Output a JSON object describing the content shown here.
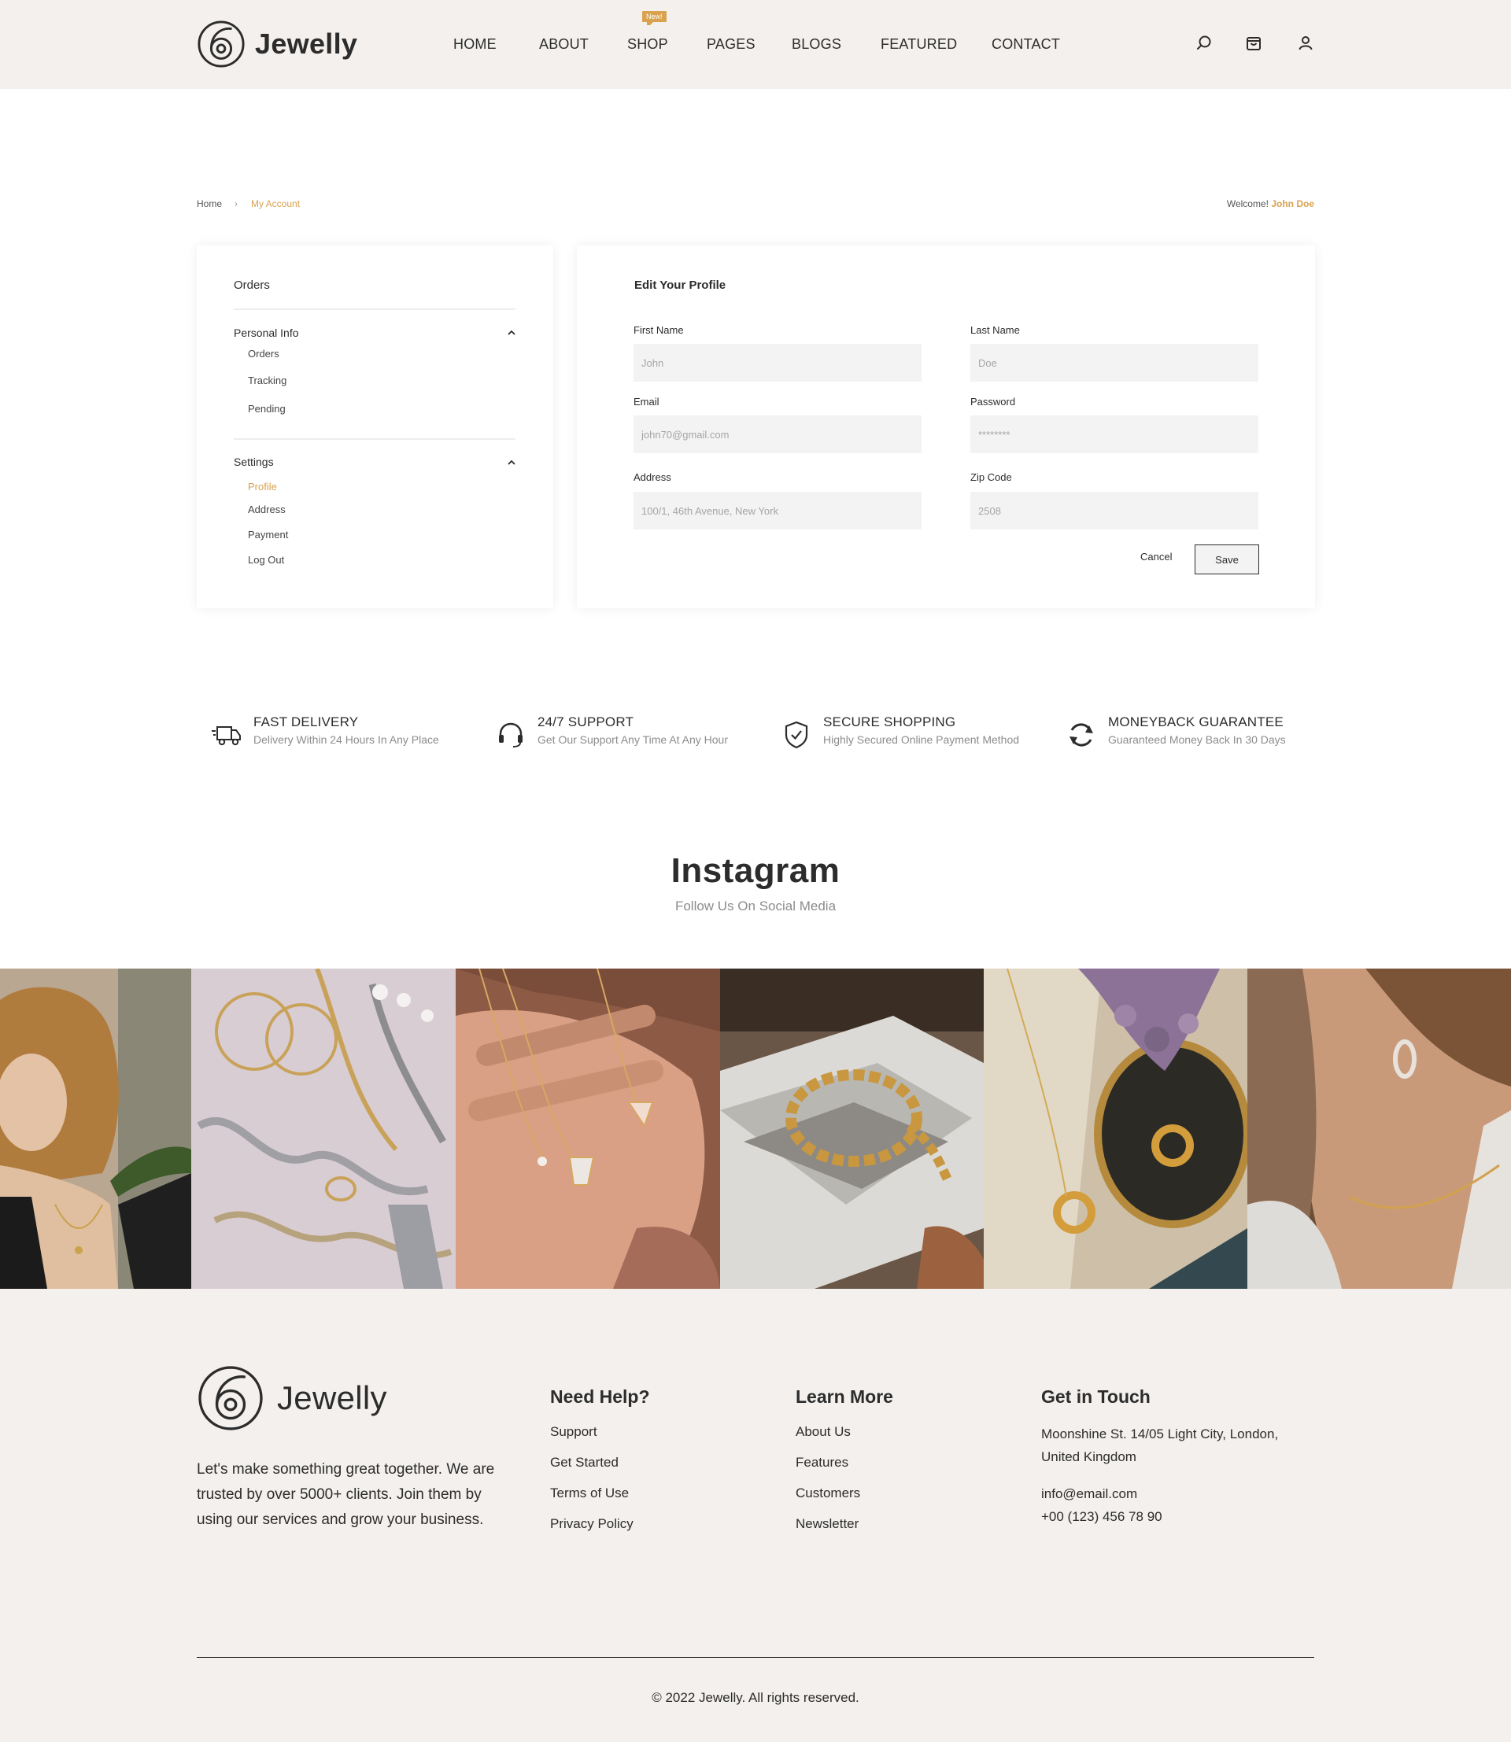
{
  "header": {
    "brand": "Jewelly",
    "nav": [
      "HOME",
      "ABOUT",
      "SHOP",
      "PAGES",
      "BLOGS",
      "FEATURED",
      "CONTACT"
    ],
    "new_badge": "New!",
    "icons": [
      "search-icon",
      "cart-icon",
      "user-icon"
    ]
  },
  "breadcrumb": {
    "home": "Home",
    "separator": "›",
    "current": "My Account"
  },
  "welcome": {
    "prefix": "Welcome!",
    "name": "John Doe"
  },
  "sidebar": {
    "orders_title": "Orders",
    "personal_info": {
      "title": "Personal Info",
      "items": [
        "Orders",
        "Tracking",
        "Pending"
      ]
    },
    "settings": {
      "title": "Settings",
      "items": [
        "Profile",
        "Address",
        "Payment",
        "Log Out"
      ],
      "active": "Profile"
    }
  },
  "profile_form": {
    "title": "Edit  Your Profile",
    "first_name": {
      "label": "First Name",
      "placeholder": "John"
    },
    "last_name": {
      "label": "Last Name",
      "placeholder": "Doe"
    },
    "email": {
      "label": "Email",
      "placeholder": "john70@gmail.com"
    },
    "password": {
      "label": "Password",
      "placeholder": "********"
    },
    "address": {
      "label": "Address",
      "placeholder": "100/1, 46th Avenue, New York"
    },
    "zip": {
      "label": "Zip Code",
      "placeholder": "2508"
    },
    "cancel_label": "Cancel",
    "save_label": "Save"
  },
  "features": [
    {
      "icon": "delivery-truck-icon",
      "title": "FAST DELIVERY",
      "subtitle": "Delivery Within 24 Hours In Any Place"
    },
    {
      "icon": "headset-icon",
      "title": "24/7 SUPPORT",
      "subtitle": "Get Our Support Any Time At Any Hour"
    },
    {
      "icon": "shield-check-icon",
      "title": "SECURE SHOPPING",
      "subtitle": "Highly Secured Online Payment Method"
    },
    {
      "icon": "refresh-icon",
      "title": "MONEYBACK GUARANTEE",
      "subtitle": "Guaranteed Money Back In 30 Days"
    }
  ],
  "instagram": {
    "title": "Instagram",
    "subtitle": "Follow Us On Social Media"
  },
  "footer": {
    "brand": "Jewelly",
    "about": "Let's make something great together. We are trusted by over 5000+ clients. Join them by using our services and grow your business.",
    "need_help": {
      "title": "Need Help?",
      "links": [
        "Support",
        "Get Started",
        "Terms of Use",
        "Privacy Policy"
      ]
    },
    "learn_more": {
      "title": "Learn More",
      "links": [
        "About Us",
        "Features",
        "Customers",
        "Newsletter"
      ]
    },
    "get_in_touch": {
      "title": "Get in Touch",
      "address": "Moonshine St. 14/05 Light City, London, United Kingdom",
      "email": "info@email.com",
      "phone": "+00 (123) 456 78 90"
    },
    "copyright": "© 2022 Jewelly. All rights reserved."
  },
  "colors": {
    "accent": "#d9a24f",
    "header_bg": "#f3f0ed",
    "text": "#2c2c2c",
    "input_bg": "#f3f3f3"
  }
}
